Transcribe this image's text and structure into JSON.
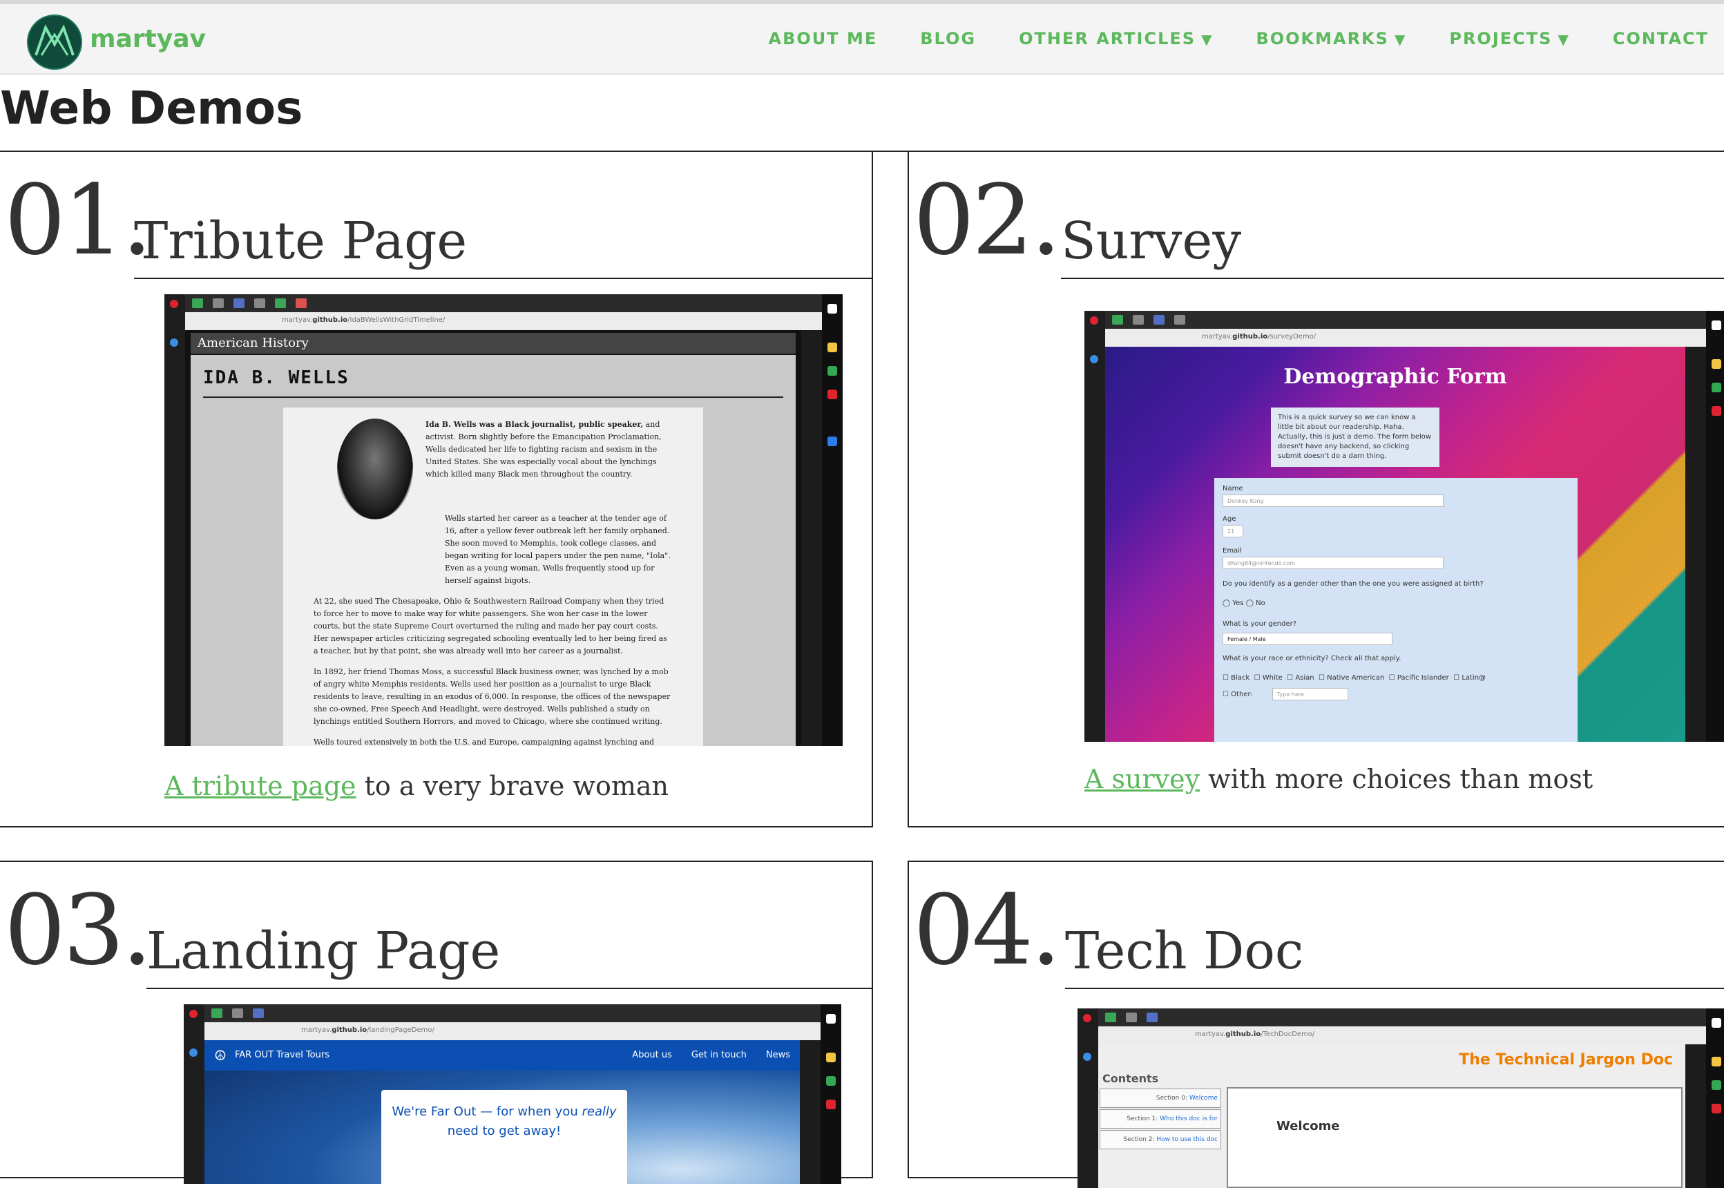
{
  "site": {
    "brand": "martyav",
    "logo": "martyav-logo-icon"
  },
  "nav": {
    "items": [
      {
        "label": "ABOUT ME",
        "dropdown": false
      },
      {
        "label": "BLOG",
        "dropdown": false
      },
      {
        "label": "OTHER ARTICLES",
        "dropdown": true
      },
      {
        "label": "BOOKMARKS",
        "dropdown": true
      },
      {
        "label": "PROJECTS",
        "dropdown": true
      },
      {
        "label": "CONTACT",
        "dropdown": false
      }
    ],
    "caret": "▼"
  },
  "page": {
    "title": "Web Demos"
  },
  "demos": [
    {
      "num": "01.",
      "title": "Tribute Page",
      "link": "A tribute page",
      "caption": " to a very brave woman",
      "shot": {
        "url_prefix": "martyav.",
        "url_host": "github.io",
        "url_path": "/IdaBWellsWithGridTimeline/",
        "bar": "American History",
        "heading": "IDA B. WELLS",
        "p1_lead": "Ida B. Wells was a Black journalist, public speaker,",
        "p1": "and activist. Born slightly before the Emancipation Proclamation, Wells dedicated her life to fighting racism and sexism in the United States. She was especially vocal about the lynchings which killed many Black men throughout the country.",
        "p2": "Wells started her career as a teacher at the tender age of 16, after a yellow fever outbreak left her family orphaned. She soon moved to Memphis, took college classes, and began writing for local papers under the pen name, \"Iola\". Even as a young woman, Wells frequently stood up for herself against bigots.",
        "p3": "At 22, she sued The Chesapeake, Ohio & Southwestern Railroad Company when they tried to force her to move to make way for white passengers. She won her case in the lower courts, but the state Supreme Court overturned the ruling and made her pay court costs. Her newspaper articles criticizing segregated schooling eventually led to her being fired as a teacher, but by that point, she was already well into her career as a journalist.",
        "p4": "In 1892, her friend Thomas Moss, a successful Black business owner, was lynched by a mob of angry white Memphis residents. Wells used her position as a journalist to urge Black residents to leave, resulting in an exodus of 6,000. In response, the offices of the newspaper she co-owned, Free Speech And Headlight, were destroyed. Wells published a study on lynchings entitled Southern Horrors, and moved to Chicago, where she continued writing.",
        "p5": "Wells toured extensively in both the U.S. and Europe, campaigning against lynching and"
      }
    },
    {
      "num": "02.",
      "title": "Survey",
      "link": "A survey",
      "caption": " with more choices than most",
      "shot": {
        "url_prefix": "martyav.",
        "url_host": "github.io",
        "url_path": "/surveyDemo/",
        "heading": "Demographic Form",
        "desc": "This is a quick survey so we can know a little bit about our readership. Haha. Actually, this is just a demo. The form below doesn't have any backend, so clicking submit doesn't do a darn thing.",
        "name_label": "Name",
        "name_value": "Donkey Kong",
        "age_label": "Age",
        "age_value": "21",
        "email_label": "Email",
        "email_value": "dKong84@nintendo.com",
        "q1": "Do you identify as a gender other than the one you were assigned at birth?",
        "yes": "Yes",
        "no": "No",
        "q2": "What is your gender?",
        "gender_selected": "Female",
        "gender_next": "Male",
        "q3": "What is your race or ethnicity? Check all that apply.",
        "races": [
          "Black",
          "White",
          "Asian",
          "Native American",
          "Pacific Islander",
          "Latin@"
        ],
        "other_label": "Other:",
        "other_placeholder": "Type here"
      }
    },
    {
      "num": "03.",
      "title": "Landing Page",
      "shot": {
        "url_prefix": "martyav.",
        "url_host": "github.io",
        "url_path": "/landingPageDemo/",
        "brand": "FAR OUT Travel Tours",
        "links": [
          "About us",
          "Get in touch",
          "News"
        ],
        "hero_pre": "We're Far Out — for when you ",
        "hero_em": "really",
        "hero_post": "need to get away!"
      }
    },
    {
      "num": "04.",
      "title": "Tech Doc",
      "shot": {
        "url_prefix": "martyav.",
        "url_host": "github.io",
        "url_path": "/TechDocDemo/",
        "heading": "The Technical Jargon Doc",
        "contents": "Contents",
        "sections": [
          {
            "prefix": "Section 0: ",
            "link": "Welcome"
          },
          {
            "prefix": "Section 1: ",
            "link": "Who this doc is for"
          },
          {
            "prefix": "Section 2: ",
            "link": "How to use this doc"
          }
        ],
        "welcome": "Welcome"
      }
    }
  ],
  "colors": {
    "accent": "#5cb85c",
    "text": "#333333",
    "rule": "#222222",
    "nav_bg": "#f4f4f4"
  }
}
